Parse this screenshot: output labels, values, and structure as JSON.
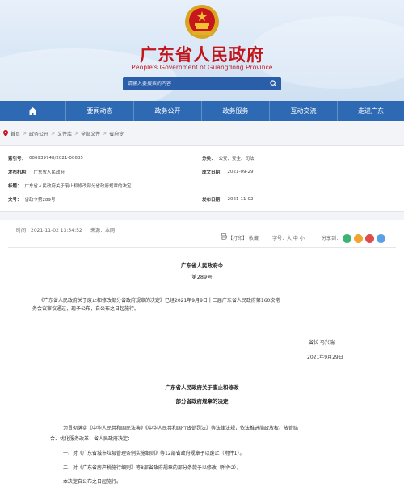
{
  "header": {
    "title": "广东省人民政府",
    "subtitle": "People's Government of Guangdong Province",
    "search_placeholder": "请输入要搜索的内容",
    "colors": {
      "brand_red": "#c3161c",
      "nav_blue": "#2e6ab4"
    }
  },
  "nav": {
    "home_icon": "home-icon",
    "items": [
      "要闻动态",
      "政务公开",
      "政务服务",
      "互动交流",
      "走进广东"
    ]
  },
  "breadcrumb": [
    "首页",
    "政务公开",
    "文件库",
    "全部文件",
    "省府令"
  ],
  "info": {
    "index_label": "索引号：",
    "index_value": "006939748/2021-00685",
    "category_label": "分类：",
    "category_value": "公安、安全、司法",
    "issuer_label": "发布机构：",
    "issuer_value": "广东省人民政府",
    "date_label": "成文日期：",
    "date_value": "2021-09-29",
    "title_label": "标题：",
    "title_value": "广东省人民政府关于废止和修改部分省政府规章的决定",
    "doc_no_label": "文号：",
    "doc_no_value": "省政令第289号",
    "pub_label": "发布日期：",
    "pub_value": "2021-11-02"
  },
  "meta": {
    "time": "时间：2021-11-02 13:54:52",
    "source": "来源：本网",
    "print": "【打印】",
    "favorite": "收藏",
    "font_size": "字号：大  中  小",
    "share": "分享到："
  },
  "article": {
    "decree_title": "广东省人民政府令",
    "decree_no": "第289号",
    "body_line1": "《广东省人民政府关于废止和修改部分省政府规章的决定》已经2021年9月9日十三届广东省人民政府第160次常",
    "body_line2": "务会议审议通过，现予公布，自公布之日起施行。",
    "signer": "省长    马兴瑞",
    "sign_date": "2021年9月29日",
    "section_title1": "广东省人民政府关于废止和修改",
    "section_title2": "部分省政府规章的决定",
    "para1_line1": "为贯彻落实《中华人民共和国民法典》《中华人民共和国行政处罚法》等法律法规，依法推进简政放权、放管结",
    "para1_line2": "合、优化服务改革，省人民政府决定：",
    "item1": "一、对《广东省城市垃圾管理条例实施细则》等12部省政府规章予以废止（附件1）。",
    "item2": "二、对《广东省房产税施行细则》等8部省政府规章的部分条款予以修改（附件2）。",
    "closing": "本决定自公布之日起施行。"
  }
}
